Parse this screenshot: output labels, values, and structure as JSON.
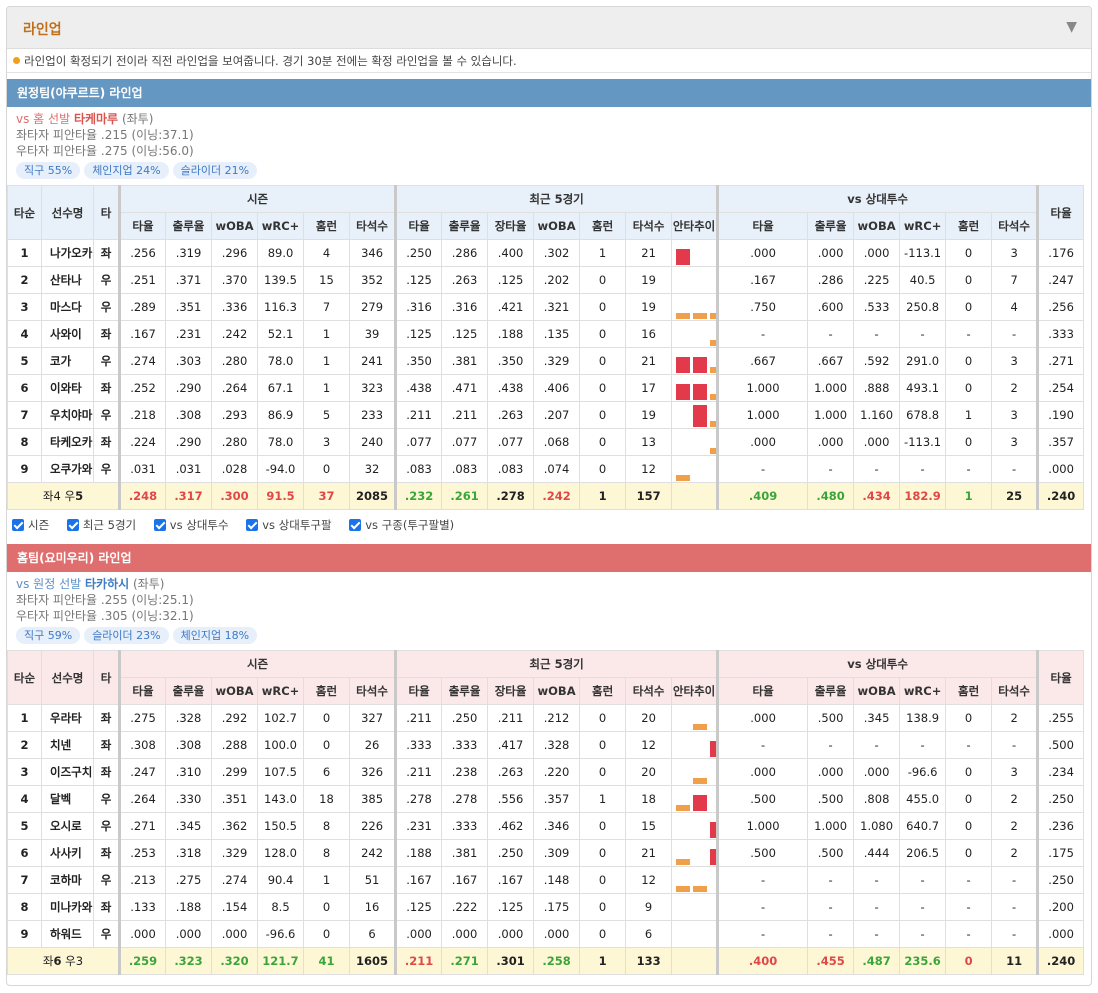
{
  "header": {
    "title": "라인업",
    "toggle_icon": "triangle-down-icon"
  },
  "notice": "라인업이 확정되기 전이라 직전 라인업을 보여줍니다. 경기 30분 전에는 확정 라인업을 볼 수 있습니다.",
  "columns": {
    "order": "타순",
    "name": "선수명",
    "bat": "타",
    "season": "시즌",
    "recent": "최근 5경기",
    "vsp": "vs 상대투수",
    "avg": "타율",
    "obp": "출루율",
    "slg": "장타율",
    "woba": "wOBA",
    "wrc": "wRC+",
    "hr": "홈런",
    "pa": "타석수",
    "trend": "안타추이",
    "avg2": "타율"
  },
  "checkboxes": [
    "시즌",
    "최근 5경기",
    "vs 상대투수",
    "vs 상대투구팔",
    "vs 구종(투구팔별)"
  ],
  "away": {
    "bar": "원정팀(야쿠르트) 라인업",
    "vs_label": "vs 홈 선발",
    "pitcher": "타케마루",
    "hand": "(좌투)",
    "line1": "좌타자 피안타율 .215 (이닝:37.1)",
    "line2": "우타자 피안타율 .275 (이닝:56.0)",
    "chips": [
      "직구 55%",
      "체인지업 24%",
      "슬라이더 21%"
    ],
    "rows": [
      {
        "n": "1",
        "name": "나가오카",
        "h": "좌",
        "s": [
          ".256",
          ".319",
          ".296",
          "89.0",
          "4",
          "346"
        ],
        "r": [
          ".250",
          ".286",
          ".400",
          ".302",
          "1",
          "21"
        ],
        "trend": [
          2,
          0,
          0,
          1,
          2
        ],
        "v": [
          ".000",
          ".000",
          ".000",
          "-113.1",
          "0",
          "3"
        ],
        "a": ".176"
      },
      {
        "n": "2",
        "name": "산타나",
        "h": "우",
        "s": [
          ".251",
          ".371",
          ".370",
          "139.5",
          "15",
          "352"
        ],
        "r": [
          ".125",
          ".263",
          ".125",
          ".202",
          "0",
          "19"
        ],
        "trend": [
          0,
          0,
          0,
          0,
          2
        ],
        "v": [
          ".167",
          ".286",
          ".225",
          "40.5",
          "0",
          "7"
        ],
        "a": ".247"
      },
      {
        "n": "3",
        "name": "마스다",
        "h": "우",
        "s": [
          ".289",
          ".351",
          ".336",
          "116.3",
          "7",
          "279"
        ],
        "r": [
          ".316",
          ".316",
          ".421",
          ".321",
          "0",
          "19"
        ],
        "trend": [
          1,
          1,
          1,
          1,
          2
        ],
        "v": [
          ".750",
          ".600",
          ".533",
          "250.8",
          "0",
          "4"
        ],
        "a": ".256"
      },
      {
        "n": "4",
        "name": "사와이",
        "h": "좌",
        "s": [
          ".167",
          ".231",
          ".242",
          "52.1",
          "1",
          "39"
        ],
        "r": [
          ".125",
          ".125",
          ".188",
          ".135",
          "0",
          "16"
        ],
        "trend": [
          0,
          0,
          1,
          0,
          1
        ],
        "v": [
          "-",
          "-",
          "-",
          "-",
          "-",
          "-"
        ],
        "a": ".333"
      },
      {
        "n": "5",
        "name": "코가",
        "h": "우",
        "s": [
          ".274",
          ".303",
          ".280",
          "78.0",
          "1",
          "241"
        ],
        "r": [
          ".350",
          ".381",
          ".350",
          ".329",
          "0",
          "21"
        ],
        "trend": [
          2,
          2,
          1,
          2,
          0
        ],
        "v": [
          ".667",
          ".667",
          ".592",
          "291.0",
          "0",
          "3"
        ],
        "a": ".271"
      },
      {
        "n": "6",
        "name": "이와타",
        "h": "좌",
        "s": [
          ".252",
          ".290",
          ".264",
          "67.1",
          "1",
          "323"
        ],
        "r": [
          ".438",
          ".471",
          ".438",
          ".406",
          "0",
          "17"
        ],
        "trend": [
          2,
          2,
          1,
          0,
          2
        ],
        "v": [
          "1.000",
          "1.000",
          ".888",
          "493.1",
          "0",
          "2"
        ],
        "a": ".254"
      },
      {
        "n": "7",
        "name": "우치야마",
        "h": "우",
        "s": [
          ".218",
          ".308",
          ".293",
          "86.9",
          "5",
          "233"
        ],
        "r": [
          ".211",
          ".211",
          ".263",
          ".207",
          "0",
          "19"
        ],
        "trend": [
          0,
          3,
          1,
          0,
          0
        ],
        "v": [
          "1.000",
          "1.000",
          "1.160",
          "678.8",
          "1",
          "3"
        ],
        "a": ".190"
      },
      {
        "n": "8",
        "name": "타케오카",
        "h": "좌",
        "s": [
          ".224",
          ".290",
          ".280",
          "78.0",
          "3",
          "240"
        ],
        "r": [
          ".077",
          ".077",
          ".077",
          ".068",
          "0",
          "13"
        ],
        "trend": [
          0,
          0,
          1,
          0,
          0
        ],
        "v": [
          ".000",
          ".000",
          ".000",
          "-113.1",
          "0",
          "3"
        ],
        "a": ".357"
      },
      {
        "n": "9",
        "name": "오쿠가와",
        "h": "우",
        "s": [
          ".031",
          ".031",
          ".028",
          "-94.0",
          "0",
          "32"
        ],
        "r": [
          ".083",
          ".083",
          ".083",
          ".074",
          "0",
          "12"
        ],
        "trend": [
          1,
          0,
          0,
          0,
          0
        ],
        "v": [
          "-",
          "-",
          "-",
          "-",
          "-",
          "-"
        ],
        "a": ".000"
      }
    ],
    "total": {
      "label_pre": "좌4 우",
      "label_bold": "5",
      "s": [
        ".248",
        ".317",
        ".300",
        "91.5",
        "37",
        "2085"
      ],
      "r": [
        ".232",
        ".261",
        ".278",
        ".242",
        "1",
        "157"
      ],
      "v": [
        ".409",
        ".480",
        ".434",
        "182.9",
        "1",
        "25"
      ],
      "a": ".240"
    }
  },
  "home": {
    "bar": "홈팀(요미우리) 라인업",
    "vs_label": "vs 원정 선발",
    "pitcher": "타카하시",
    "hand": "(좌투)",
    "line1": "좌타자 피안타율 .255 (이닝:25.1)",
    "line2": "우타자 피안타율 .305 (이닝:32.1)",
    "chips": [
      "직구 59%",
      "슬라이더 23%",
      "체인지업 18%"
    ],
    "rows": [
      {
        "n": "1",
        "name": "우라타",
        "h": "좌",
        "s": [
          ".275",
          ".328",
          ".292",
          "102.7",
          "0",
          "327"
        ],
        "r": [
          ".211",
          ".250",
          ".211",
          ".212",
          "0",
          "20"
        ],
        "trend": [
          0,
          1,
          0,
          2,
          1
        ],
        "v": [
          ".000",
          ".500",
          ".345",
          "138.9",
          "0",
          "2"
        ],
        "a": ".255"
      },
      {
        "n": "2",
        "name": "치넨",
        "h": "좌",
        "s": [
          ".308",
          ".308",
          ".288",
          "100.0",
          "0",
          "26"
        ],
        "r": [
          ".333",
          ".333",
          ".417",
          ".328",
          "0",
          "12"
        ],
        "trend": [
          0,
          0,
          2,
          2,
          0
        ],
        "v": [
          "-",
          "-",
          "-",
          "-",
          "-",
          "-"
        ],
        "a": ".500"
      },
      {
        "n": "3",
        "name": "이즈구치",
        "h": "좌",
        "s": [
          ".247",
          ".310",
          ".299",
          "107.5",
          "6",
          "326"
        ],
        "r": [
          ".211",
          ".238",
          ".263",
          ".220",
          "0",
          "20"
        ],
        "trend": [
          0,
          1,
          0,
          3,
          0
        ],
        "v": [
          ".000",
          ".000",
          ".000",
          "-96.6",
          "0",
          "3"
        ],
        "a": ".234"
      },
      {
        "n": "4",
        "name": "달벡",
        "h": "우",
        "s": [
          ".264",
          ".330",
          ".351",
          "143.0",
          "18",
          "385"
        ],
        "r": [
          ".278",
          ".278",
          ".556",
          ".357",
          "1",
          "18"
        ],
        "trend": [
          1,
          2,
          0,
          2,
          0
        ],
        "v": [
          ".500",
          ".500",
          ".808",
          "455.0",
          "0",
          "2"
        ],
        "a": ".250"
      },
      {
        "n": "5",
        "name": "오시로",
        "h": "우",
        "s": [
          ".271",
          ".345",
          ".362",
          "150.5",
          "8",
          "226"
        ],
        "r": [
          ".231",
          ".333",
          ".462",
          ".346",
          "0",
          "15"
        ],
        "trend": [
          0,
          0,
          2,
          3,
          1
        ],
        "v": [
          "1.000",
          "1.000",
          "1.080",
          "640.7",
          "0",
          "2"
        ],
        "a": ".236"
      },
      {
        "n": "6",
        "name": "사사키",
        "h": "좌",
        "s": [
          ".253",
          ".318",
          ".329",
          "128.0",
          "8",
          "242"
        ],
        "r": [
          ".188",
          ".381",
          ".250",
          ".309",
          "0",
          "21"
        ],
        "trend": [
          1,
          0,
          2,
          0,
          0
        ],
        "v": [
          ".500",
          ".500",
          ".444",
          "206.5",
          "0",
          "2"
        ],
        "a": ".175"
      },
      {
        "n": "7",
        "name": "코하마",
        "h": "우",
        "s": [
          ".213",
          ".275",
          ".274",
          "90.4",
          "1",
          "51"
        ],
        "r": [
          ".167",
          ".167",
          ".167",
          ".148",
          "0",
          "12"
        ],
        "trend": [
          1,
          1,
          0,
          0,
          0
        ],
        "v": [
          "-",
          "-",
          "-",
          "-",
          "-",
          "-"
        ],
        "a": ".250"
      },
      {
        "n": "8",
        "name": "미나카와",
        "h": "좌",
        "s": [
          ".133",
          ".188",
          ".154",
          "8.5",
          "0",
          "16"
        ],
        "r": [
          ".125",
          ".222",
          ".125",
          ".175",
          "0",
          "9"
        ],
        "trend": [
          0,
          0,
          0,
          1,
          0
        ],
        "v": [
          "-",
          "-",
          "-",
          "-",
          "-",
          "-"
        ],
        "a": ".200"
      },
      {
        "n": "9",
        "name": "하워드",
        "h": "우",
        "s": [
          ".000",
          ".000",
          ".000",
          "-96.6",
          "0",
          "6"
        ],
        "r": [
          ".000",
          ".000",
          ".000",
          ".000",
          "0",
          "6"
        ],
        "trend": [
          0,
          0,
          0,
          0,
          0
        ],
        "v": [
          "-",
          "-",
          "-",
          "-",
          "-",
          "-"
        ],
        "a": ".000"
      }
    ],
    "total": {
      "label_pre": "좌",
      "label_bold": "6",
      "label_post": " 우3",
      "s": [
        ".259",
        ".323",
        ".320",
        "121.7",
        "41",
        "1605"
      ],
      "r": [
        ".211",
        ".271",
        ".301",
        ".258",
        "1",
        "133"
      ],
      "v": [
        ".400",
        ".455",
        ".487",
        "235.6",
        "0",
        "11"
      ],
      "a": ".240"
    }
  },
  "colors": {
    "hit_bar": "#e23a4a",
    "out_bar": "#f0a04b",
    "away": "#6597c3",
    "home": "#df6e6e"
  }
}
